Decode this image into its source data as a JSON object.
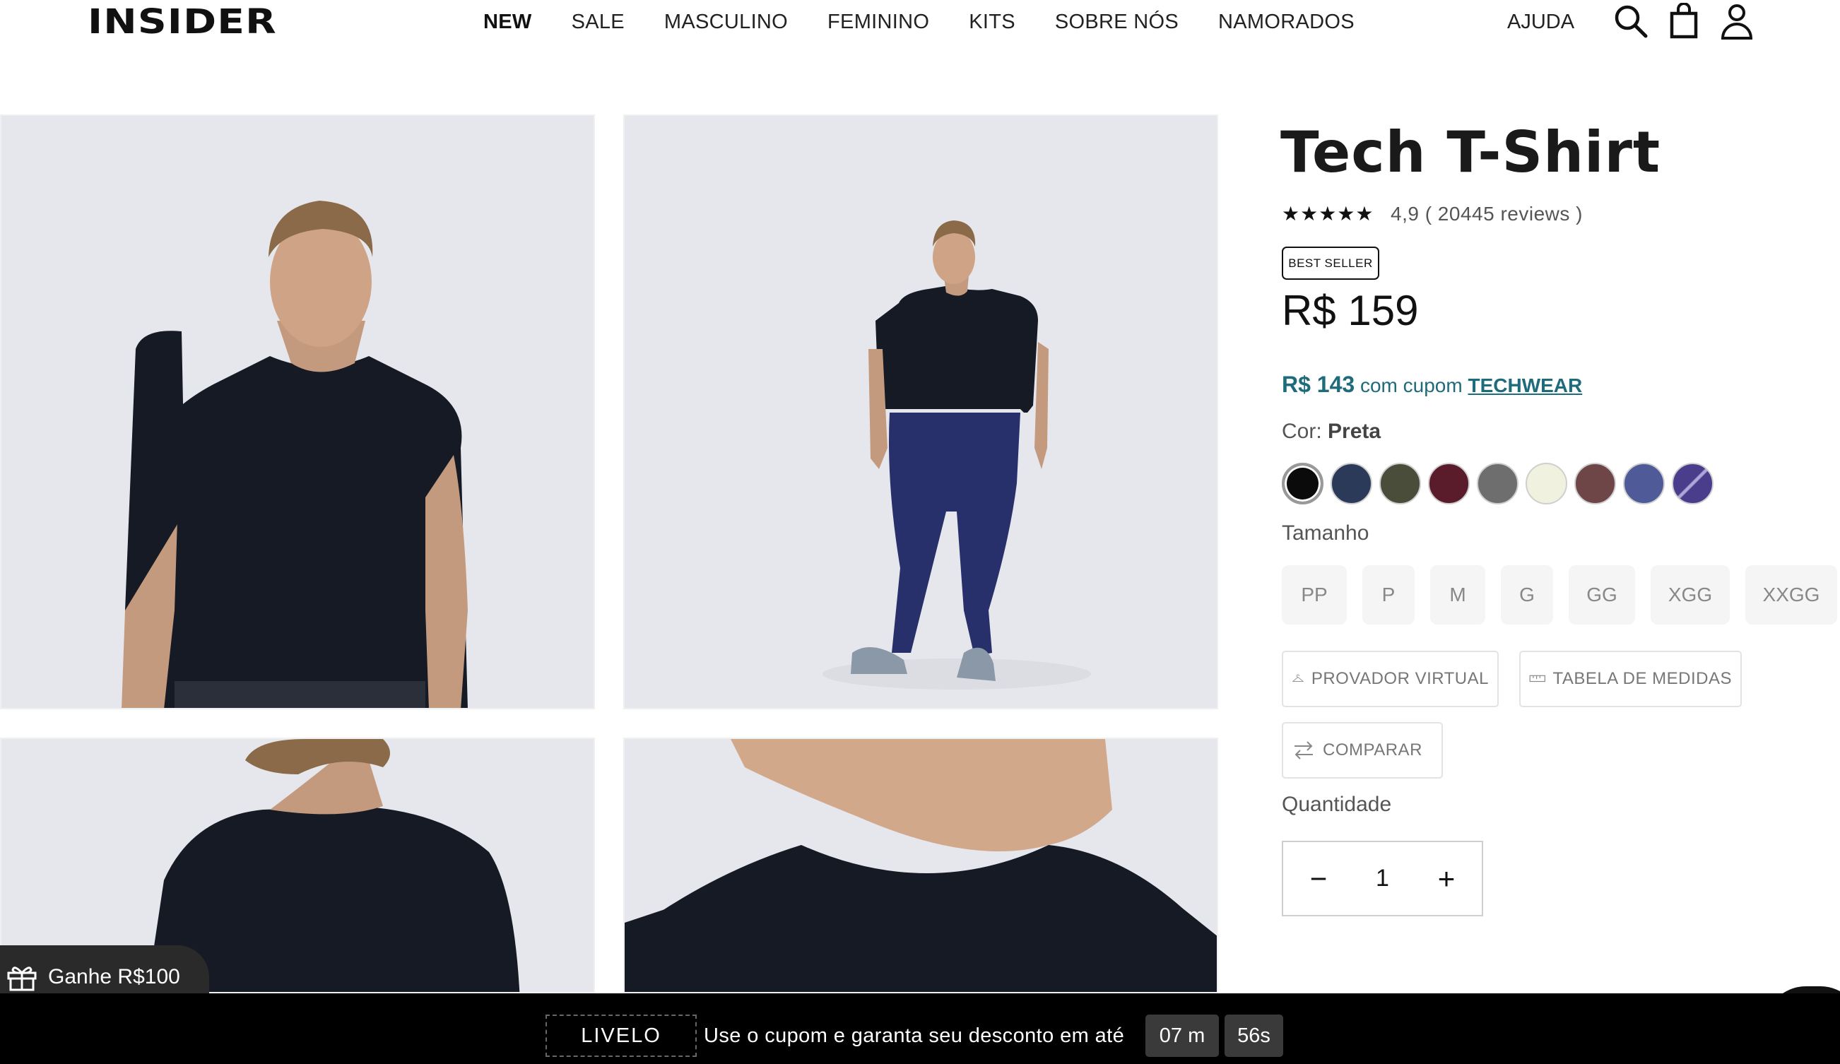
{
  "header": {
    "logo": "INSIDER",
    "nav": [
      {
        "label": "NEW",
        "active": true
      },
      {
        "label": "SALE"
      },
      {
        "label": "MASCULINO"
      },
      {
        "label": "FEMININO"
      },
      {
        "label": "KITS"
      },
      {
        "label": "SOBRE NÓS"
      },
      {
        "label": "NAMORADOS"
      }
    ],
    "help": "AJUDA",
    "icons": [
      "search-icon",
      "bag-icon",
      "user-icon"
    ]
  },
  "gallery": [
    {
      "alt": "front-closeup"
    },
    {
      "alt": "full-body"
    },
    {
      "alt": "back-shoulder"
    },
    {
      "alt": "neckline-detail"
    }
  ],
  "product": {
    "title": "Tech T-Shirt",
    "stars": "★★★★★",
    "rating": "4,9 ( 20445 reviews )",
    "badge": "BEST SELLER",
    "price": "R$ 159",
    "coupon_price": "R$ 143",
    "coupon_text": "com cupom",
    "coupon_code": "TECHWEAR",
    "color_label": "Cor:",
    "color_value": "Preta",
    "colors": [
      "#0b0b0b",
      "#2c3a5a",
      "#494d3a",
      "#5a1b2b",
      "#6e6e6e",
      "#f1f1df",
      "#6e4648",
      "#4f5b98",
      "#4a3e8c"
    ],
    "size_label": "Tamanho",
    "sizes": [
      "PP",
      "P",
      "M",
      "G",
      "GG",
      "XGG",
      "XXGG"
    ],
    "tools": {
      "virtual": "PROVADOR VIRTUAL",
      "measures": "TABELA DE MEDIDAS",
      "compare": "COMPARAR"
    },
    "quantity_label": "Quantidade",
    "quantity": "1",
    "minus": "−",
    "plus": "+"
  },
  "gift": {
    "label": "Ganhe R$100"
  },
  "promo_bar": {
    "code": "LIVELO",
    "text": "Use o cupom e garanta seu desconto em até",
    "minutes": "07 m",
    "seconds": "56s"
  }
}
